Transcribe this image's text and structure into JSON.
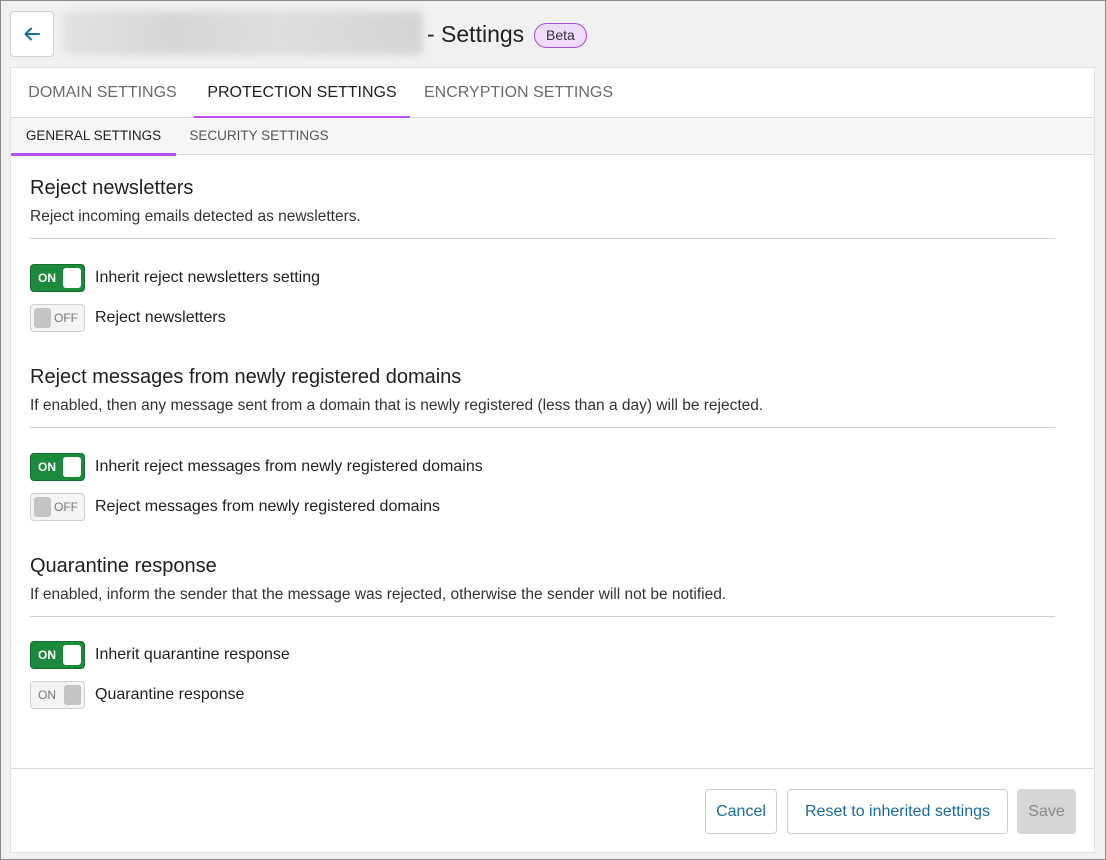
{
  "header": {
    "back_icon": "arrow-left-icon",
    "title": "- Settings",
    "badge": "Beta"
  },
  "tabs": [
    {
      "label": "DOMAIN SETTINGS",
      "active": false
    },
    {
      "label": "PROTECTION SETTINGS",
      "active": true
    },
    {
      "label": "ENCRYPTION SETTINGS",
      "active": false
    }
  ],
  "subtabs": [
    {
      "label": "GENERAL SETTINGS",
      "active": true
    },
    {
      "label": "SECURITY SETTINGS",
      "active": false
    }
  ],
  "sections": [
    {
      "title": "Reject newsletters",
      "description": "Reject incoming emails detected as newsletters.",
      "toggles": [
        {
          "state": "ON",
          "label": "Inherit reject newsletters setting"
        },
        {
          "state": "OFF",
          "label": "Reject newsletters"
        }
      ]
    },
    {
      "title": "Reject messages from newly registered domains",
      "description": "If enabled, then any message sent from a domain that is newly registered (less than a day) will be rejected.",
      "toggles": [
        {
          "state": "ON",
          "label": "Inherit reject messages from newly registered domains"
        },
        {
          "state": "OFF",
          "label": "Reject messages from newly registered domains"
        }
      ]
    },
    {
      "title": "Quarantine response",
      "description": "If enabled, inform the sender that the message was rejected, otherwise the sender will not be notified.",
      "toggles": [
        {
          "state": "ON",
          "label": "Inherit quarantine response"
        },
        {
          "state": "ON",
          "label": "Quarantine response"
        }
      ]
    }
  ],
  "footer": {
    "cancel": "Cancel",
    "reset": "Reset to inherited settings",
    "save": "Save"
  },
  "colors": {
    "accent": "#b84ff0",
    "toggle_on": "#1b8a3c",
    "link": "#1a6b9e"
  }
}
